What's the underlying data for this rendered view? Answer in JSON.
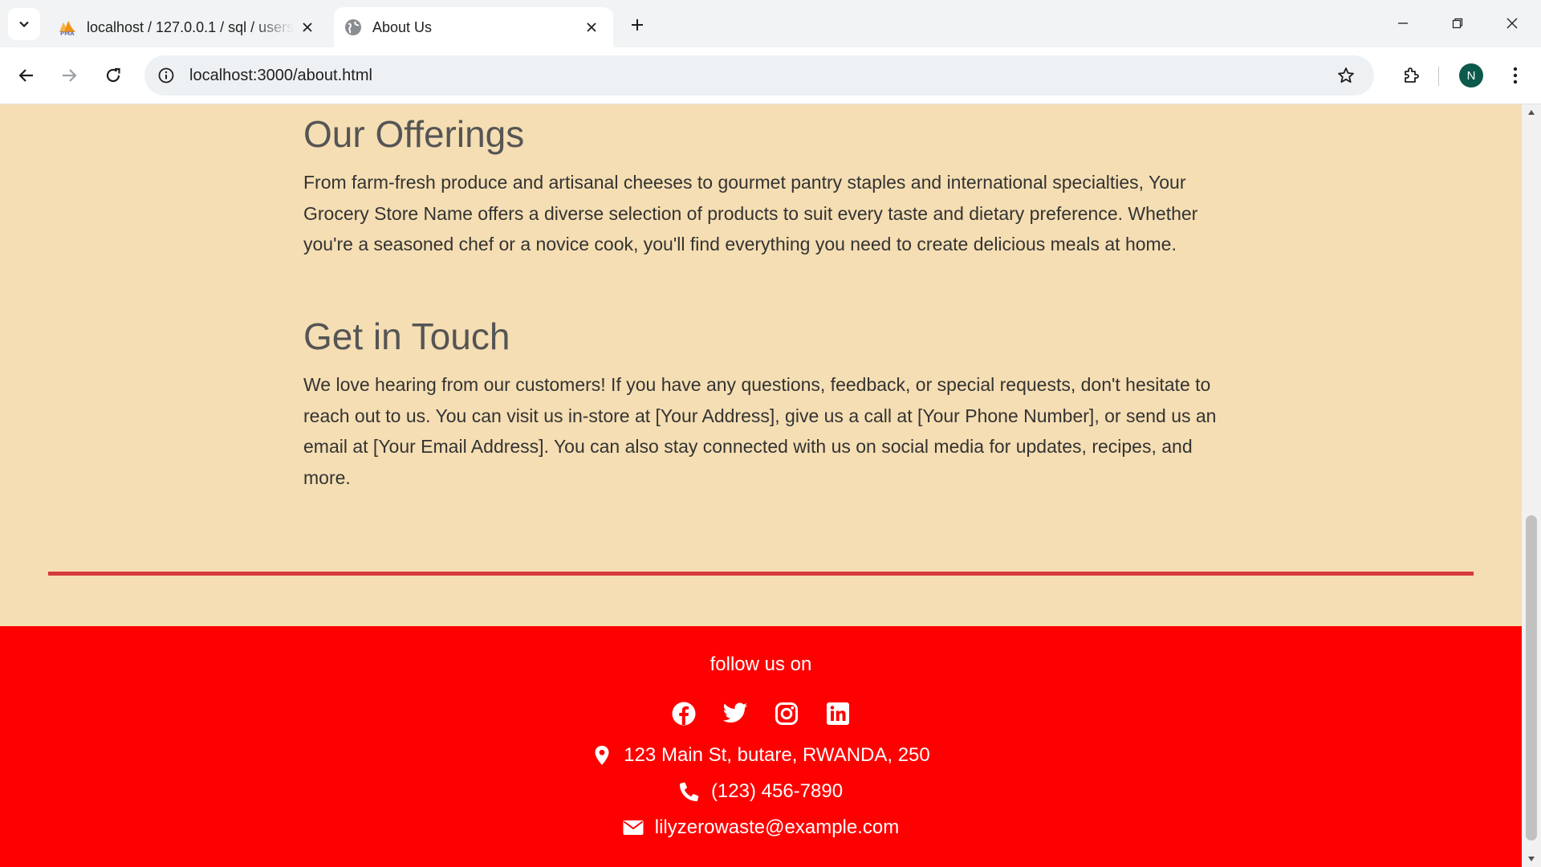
{
  "browser": {
    "tabs": [
      {
        "title": "localhost / 127.0.0.1 / sql / users",
        "active": false
      },
      {
        "title": "About Us",
        "active": true
      }
    ],
    "address": "localhost:3000/about.html",
    "profile_initial": "N"
  },
  "sections": [
    {
      "heading": "Our Offerings",
      "body": "From farm-fresh produce and artisanal cheeses to gourmet pantry staples and international specialties, Your Grocery Store Name offers a diverse selection of products to suit every taste and dietary preference. Whether you're a seasoned chef or a novice cook, you'll find everything you need to create delicious meals at home."
    },
    {
      "heading": "Get in Touch",
      "body": "We love hearing from our customers! If you have any questions, feedback, or special requests, don't hesitate to reach out to us. You can visit us in-store at [Your Address], give us a call at [Your Phone Number], or send us an email at [Your Email Address]. You can also stay connected with us on social media for updates, recipes, and more."
    }
  ],
  "footer": {
    "follow_label": "follow us on",
    "socials": [
      "facebook-icon",
      "twitter-icon",
      "instagram-icon",
      "linkedin-icon"
    ],
    "address": "123 Main St, butare, RWANDA, 250",
    "phone": "(123) 456-7890",
    "email": "lilyzerowaste@example.com"
  },
  "colors": {
    "page_background": "#f5deb3",
    "footer_background": "#ff0000",
    "divider": "#d73a3e",
    "heading": "#555555",
    "body_text": "#333333"
  }
}
